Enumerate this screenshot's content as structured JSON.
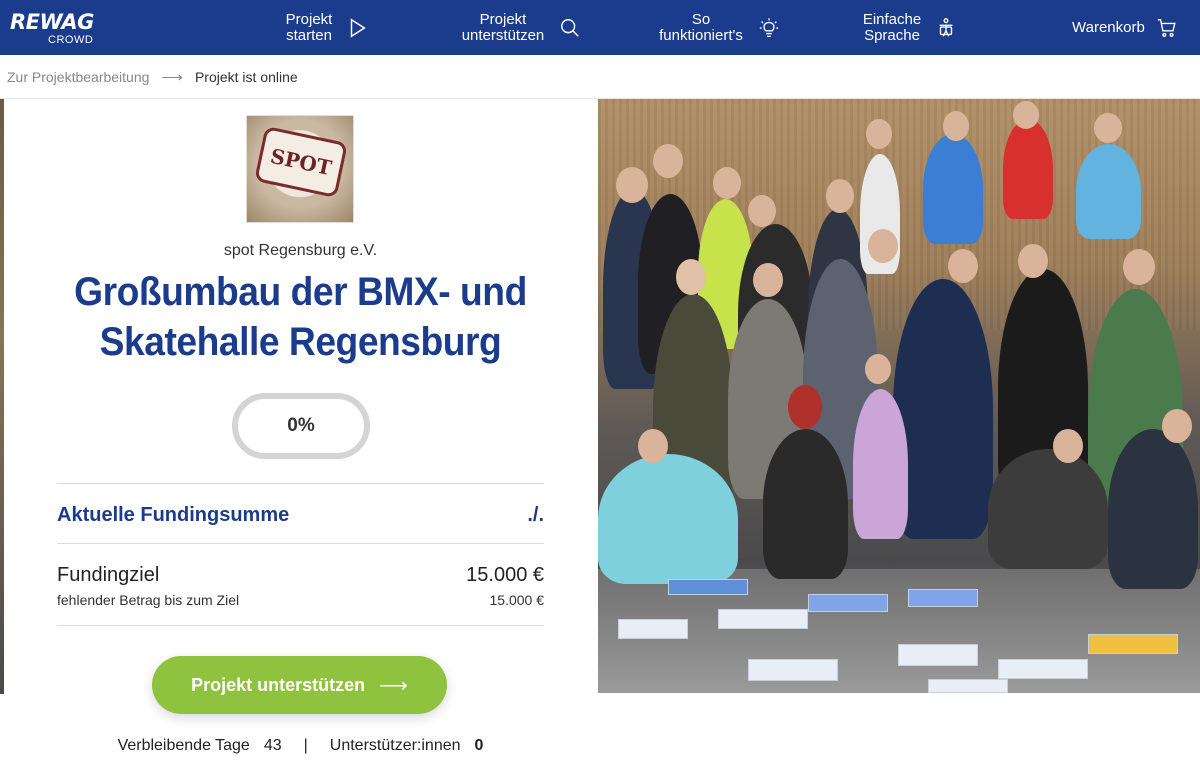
{
  "brand": {
    "name": "REWAG",
    "sub": "CROWD"
  },
  "nav": [
    {
      "label": "Projekt starten",
      "icon": "play-icon"
    },
    {
      "label": "Projekt unterstützen",
      "icon": "search-icon"
    },
    {
      "label": "So funktioniert's",
      "icon": "lightbulb-icon"
    },
    {
      "label": "Einfache Sprache",
      "icon": "accessibility-icon"
    },
    {
      "label": "Warenkorb",
      "icon": "cart-icon"
    }
  ],
  "breadcrumb": {
    "link": "Zur Projektbearbeitung",
    "arrow": "⟶",
    "current": "Projekt ist online"
  },
  "project": {
    "organization": "spot Regensburg e.V.",
    "title": "Großumbau der BMX- und Skatehalle Regensburg",
    "thumb_text": "SPOT",
    "progress": "0%",
    "progress_fraction": 0
  },
  "funding": {
    "current_label": "Aktuelle Fundingsumme",
    "current_value": "./.",
    "goal_label": "Fundingziel",
    "goal_value": "15.000 €",
    "missing_label": "fehlender Betrag bis zum Ziel",
    "missing_value": "15.000 €"
  },
  "cta": {
    "label": "Projekt unterstützen",
    "arrow": "⟶"
  },
  "stats": {
    "days_label": "Verbleibende Tage",
    "days_value": "43",
    "separator": "|",
    "supporters_label": "Unterstützer:innen",
    "supporters_value": "0"
  },
  "colors": {
    "brand_blue": "#1b3c8c",
    "cta_green": "#8fc23e"
  }
}
